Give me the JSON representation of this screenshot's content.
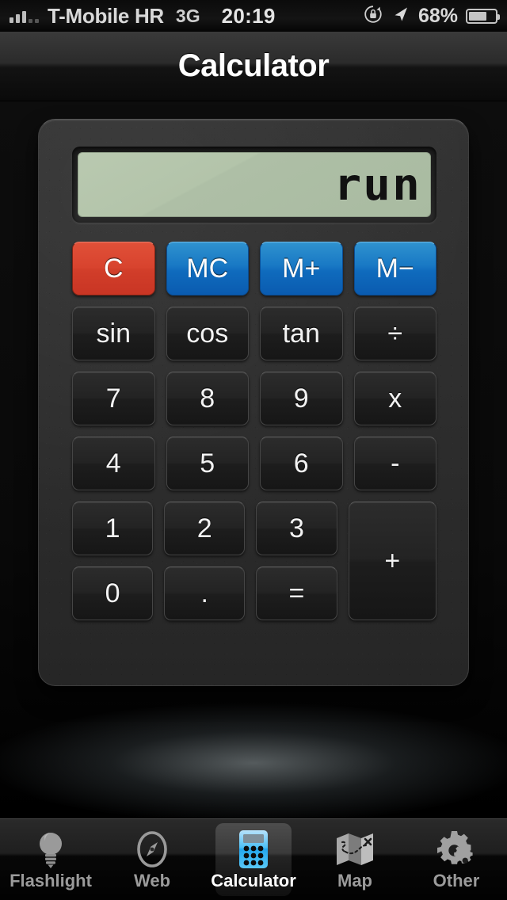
{
  "status_bar": {
    "signal_bars_filled": 3,
    "signal_bars_total": 5,
    "carrier": "T-Mobile HR",
    "network": "3G",
    "time": "20:19",
    "rotation_lock_icon": "rotation-lock-icon",
    "location_icon": "location-arrow-icon",
    "battery_percent": "68%",
    "battery_level": 68
  },
  "header": {
    "title": "Calculator"
  },
  "calculator": {
    "display": {
      "value": "run"
    },
    "rows": [
      [
        {
          "label": "C",
          "name": "clear-button",
          "style": "red"
        },
        {
          "label": "MC",
          "name": "memory-clear-button",
          "style": "blue"
        },
        {
          "label": "M+",
          "name": "memory-add-button",
          "style": "blue"
        },
        {
          "label": "M−",
          "name": "memory-subtract-button",
          "style": "blue"
        }
      ],
      [
        {
          "label": "sin",
          "name": "sin-button",
          "style": "dark"
        },
        {
          "label": "cos",
          "name": "cos-button",
          "style": "dark"
        },
        {
          "label": "tan",
          "name": "tan-button",
          "style": "dark"
        },
        {
          "label": "÷",
          "name": "divide-button",
          "style": "dark"
        }
      ],
      [
        {
          "label": "7",
          "name": "digit-7-button",
          "style": "dark"
        },
        {
          "label": "8",
          "name": "digit-8-button",
          "style": "dark"
        },
        {
          "label": "9",
          "name": "digit-9-button",
          "style": "dark"
        },
        {
          "label": "x",
          "name": "multiply-button",
          "style": "dark"
        }
      ],
      [
        {
          "label": "4",
          "name": "digit-4-button",
          "style": "dark"
        },
        {
          "label": "5",
          "name": "digit-5-button",
          "style": "dark"
        },
        {
          "label": "6",
          "name": "digit-6-button",
          "style": "dark"
        },
        {
          "label": "-",
          "name": "subtract-button",
          "style": "dark"
        }
      ]
    ],
    "grid_rows": [
      [
        {
          "label": "1",
          "name": "digit-1-button",
          "style": "dark"
        },
        {
          "label": "2",
          "name": "digit-2-button",
          "style": "dark"
        },
        {
          "label": "3",
          "name": "digit-3-button",
          "style": "dark"
        }
      ],
      [
        {
          "label": "0",
          "name": "digit-0-button",
          "style": "dark"
        },
        {
          "label": ".",
          "name": "decimal-point-button",
          "style": "dark"
        },
        {
          "label": "=",
          "name": "equals-button",
          "style": "dark"
        }
      ]
    ],
    "plus_key": {
      "label": "+",
      "name": "add-button"
    }
  },
  "tab_bar": {
    "items": [
      {
        "label": "Flashlight",
        "icon": "lightbulb-icon",
        "active": false
      },
      {
        "label": "Web",
        "icon": "compass-icon",
        "active": false
      },
      {
        "label": "Calculator",
        "icon": "calculator-icon",
        "active": true
      },
      {
        "label": "Map",
        "icon": "folded-map-icon",
        "active": false
      },
      {
        "label": "Other",
        "icon": "gears-icon",
        "active": false
      }
    ]
  },
  "colors": {
    "clear_red": "#d8432e",
    "memory_blue": "#1878c4",
    "lcd_green": "#b3c4aa",
    "body_gray": "#2e2e2e",
    "active_tab_icon_blue": "#3bb0ef"
  }
}
